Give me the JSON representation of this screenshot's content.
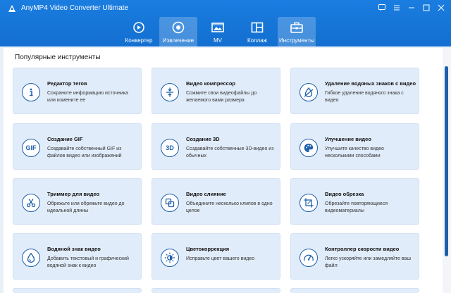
{
  "app": {
    "title": "AnyMP4 Video Converter Ultimate"
  },
  "tabs": [
    {
      "label": "Конвертер",
      "icon": "converter-icon",
      "active": false
    },
    {
      "label": "Извлечение",
      "icon": "ripper-icon",
      "active": true
    },
    {
      "label": "MV",
      "icon": "mv-icon",
      "active": false
    },
    {
      "label": "Коллаж",
      "icon": "collage-icon",
      "active": false
    },
    {
      "label": "Инструменты",
      "icon": "toolbox-icon",
      "active": false
    }
  ],
  "section_title": "Популярные инструменты",
  "tools": [
    {
      "title": "Редактор тегов",
      "desc": "Сохраните информацию источника или измените ее",
      "icon": "info-icon"
    },
    {
      "title": "Видео компрессор",
      "desc": "Сожмите свои видеофайлы до желаемого вами размера",
      "icon": "compress-icon"
    },
    {
      "title": "Удаление водяных знаков с видео",
      "desc": "Гибкое удаление водяного знака с видео",
      "icon": "watermark-remove-icon"
    },
    {
      "title": "Создание GIF",
      "desc": "Создавайте собственный GIF из файлов видео или изображений",
      "icon": "gif-icon",
      "glyph": "GIF"
    },
    {
      "title": "Создание 3D",
      "desc": "Создавайте собственные 3D-видео из обычных",
      "icon": "3d-icon",
      "glyph": "3D"
    },
    {
      "title": "Улучшение видео",
      "desc": "Улучшите качество видео несколькими способами",
      "icon": "palette-icon"
    },
    {
      "title": "Триммер для видео",
      "desc": "Обрежьте или обрежьте видео до идеальной длины",
      "icon": "scissors-icon"
    },
    {
      "title": "Видео слияние",
      "desc": "Объедините несколько клипов в одно целое",
      "icon": "merge-icon"
    },
    {
      "title": "Видео обрезка",
      "desc": "Обрезайте повторяющиеся видеоматериалы",
      "icon": "crop-icon"
    },
    {
      "title": "Водяной знак видео",
      "desc": "Добавить текстовый и графический водяной знак к видео",
      "icon": "watermark-drop-icon"
    },
    {
      "title": "Цветокоррекция",
      "desc": "Исправьте цвет вашего видео",
      "icon": "sun-icon"
    },
    {
      "title": "Контроллер скорости видео",
      "desc": "Легко ускоряйте или замедляйте ваш файл",
      "icon": "speedometer-icon"
    }
  ],
  "colors": {
    "titlebar": "#1577d8",
    "accent": "#1d5fab",
    "card": "#e1ecfa"
  }
}
